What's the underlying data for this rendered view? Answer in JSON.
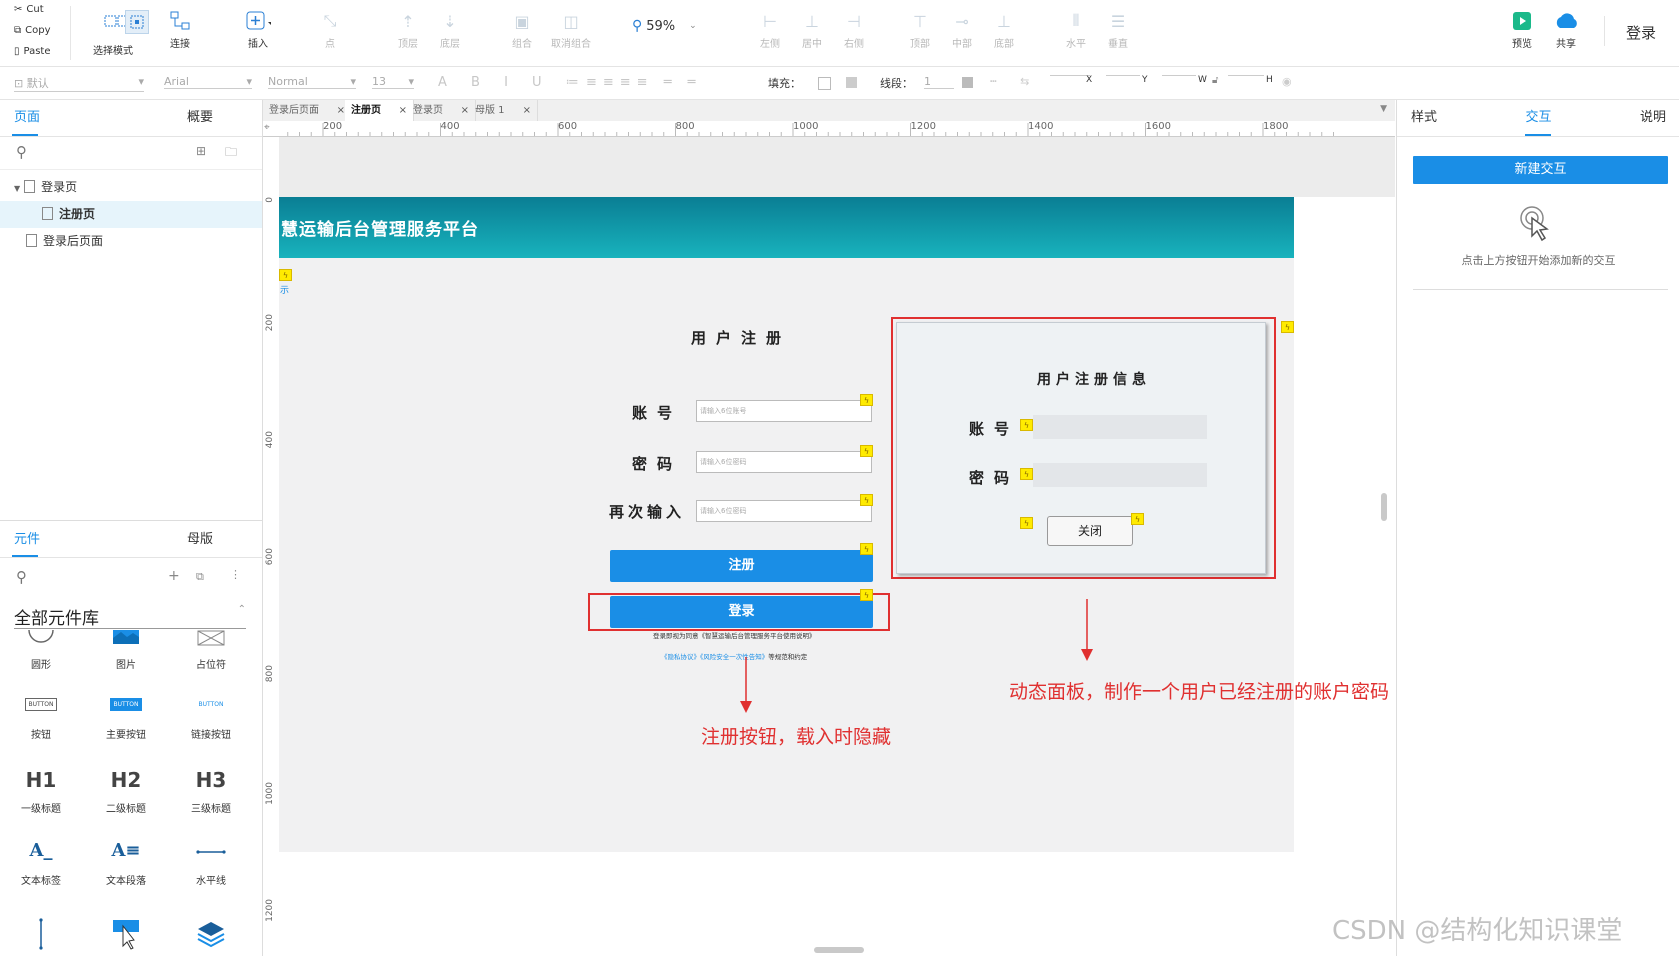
{
  "toolbar": {
    "clipboard": {
      "cut": "Cut",
      "copy": "Copy",
      "paste": "Paste"
    },
    "select_mode": "选择模式",
    "connect": "连接",
    "insert": "插入",
    "point": "点",
    "top_layer": "顶层",
    "bottom_layer": "底层",
    "group": "组合",
    "ungroup": "取消组合",
    "zoom": "59%",
    "align_left": "左侧",
    "align_center": "居中",
    "align_right": "右侧",
    "align_top": "顶部",
    "align_middle": "中部",
    "align_bottom": "底部",
    "distribute_h": "水平",
    "distribute_v": "垂直",
    "preview": "预览",
    "share": "共享",
    "login": "登录"
  },
  "format_bar": {
    "style_select": "默认",
    "font_select": "Arial",
    "weight_select": "Normal",
    "size_select": "13",
    "fill_label": "填充：",
    "line_label": "线段：",
    "line_value": "1",
    "x_label": "X",
    "y_label": "Y",
    "w_label": "W",
    "h_label": "H"
  },
  "left_panel": {
    "tabs": [
      "页面",
      "概要"
    ],
    "pages": [
      {
        "label": "登录页",
        "level": 0
      },
      {
        "label": "注册页",
        "level": 1
      },
      {
        "label": "登录后页面",
        "level": 0
      }
    ],
    "widget_tabs": [
      "元件",
      "母版"
    ],
    "library_title": "全部元件库",
    "widgets": [
      [
        "圆形",
        "图片",
        "占位符"
      ],
      [
        "按钮",
        "主要按钮",
        "链接按钮"
      ],
      [
        "一级标题",
        "二级标题",
        "三级标题"
      ],
      [
        "文本标签",
        "文本段落",
        "水平线"
      ]
    ],
    "widget_previews": {
      "button": "BUTTON",
      "h1": "H1",
      "h2": "H2",
      "h3": "H3",
      "text_label": "A_",
      "text_para": "A≡"
    }
  },
  "doc_tabs": [
    "登录后页面",
    "注册页",
    "登录页",
    "母版 1"
  ],
  "ruler_h": [
    "200",
    "400",
    "600",
    "800",
    "1000",
    "1200",
    "1400",
    "1600",
    "1800"
  ],
  "ruler_v": [
    "0",
    "200",
    "400",
    "600",
    "800",
    "1000",
    "1200"
  ],
  "canvas": {
    "header_title": "慧运输后台管理服务平台",
    "side_mark": "示",
    "register_title": "用户注册",
    "account_label": "账号",
    "account_placeholder": "请输入6位账号",
    "password_label": "密码",
    "password_placeholder": "请输入6位密码",
    "repeat_label": "再次输入",
    "repeat_placeholder": "请输入6位密码",
    "register_button": "注册",
    "login_button": "登录",
    "agreement_line1": "登录即视为同意《智慧运输后台管理服务平台使用说明》",
    "agreement_link1": "《隐私协议》",
    "agreement_link2": "《风险安全一次性告知》",
    "agreement_tail": "等规范和约定",
    "panel_title": "用户注册信息",
    "panel_account_label": "账号",
    "panel_password_label": "密码",
    "panel_close_button": "关闭",
    "annotation_left": "注册按钮，载入时隐藏",
    "annotation_right": "动态面板，制作一个用户已经注册的账户密码"
  },
  "right_panel": {
    "tabs": [
      "样式",
      "交互",
      "说明"
    ],
    "new_interaction_button": "新建交互",
    "hint": "点击上方按钮开始添加新的交互"
  },
  "watermark": "CSDN @结构化知识课堂",
  "colors": {
    "accent": "#1a8ee6",
    "header_gradient_start": "#0e8aa0",
    "annotation_red": "#e03030",
    "flag_yellow": "#ffeb00"
  }
}
